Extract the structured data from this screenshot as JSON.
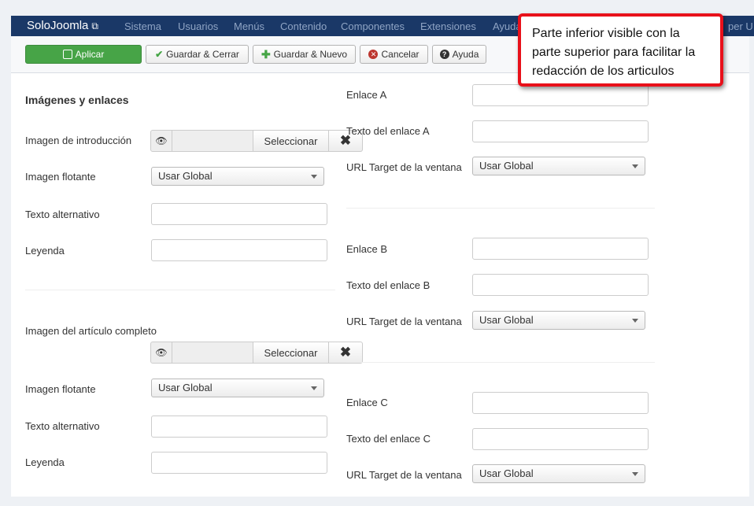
{
  "navbar": {
    "brand": "SoloJoomla",
    "items": [
      "Sistema",
      "Usuarios",
      "Menús",
      "Contenido",
      "Componentes",
      "Extensiones",
      "Ayuda"
    ],
    "user": "per U"
  },
  "toolbar": {
    "apply": "Aplicar",
    "save_close": "Guardar & Cerrar",
    "save_new": "Guardar & Nuevo",
    "cancel": "Cancelar",
    "help": "Ayuda"
  },
  "images": {
    "section_title": "Imágenes y enlaces",
    "intro_image_label": "Imagen de introducción",
    "select_label": "Seleccionar",
    "float_label": "Imagen flotante",
    "float_value": "Usar Global",
    "alt_label": "Texto alternativo",
    "caption_label": "Leyenda",
    "full_image_label": "Imagen del artículo completo"
  },
  "links": {
    "link_a": "Enlace A",
    "link_a_text": "Texto del enlace A",
    "link_b": "Enlace B",
    "link_b_text": "Texto del enlace B",
    "link_c": "Enlace C",
    "link_c_text": "Texto del enlace C",
    "target_label": "URL Target de la ventana",
    "target_value": "Usar Global"
  },
  "callout": {
    "text": "Parte inferior visible con la parte superior para facilitar la redacción de los articulos"
  }
}
